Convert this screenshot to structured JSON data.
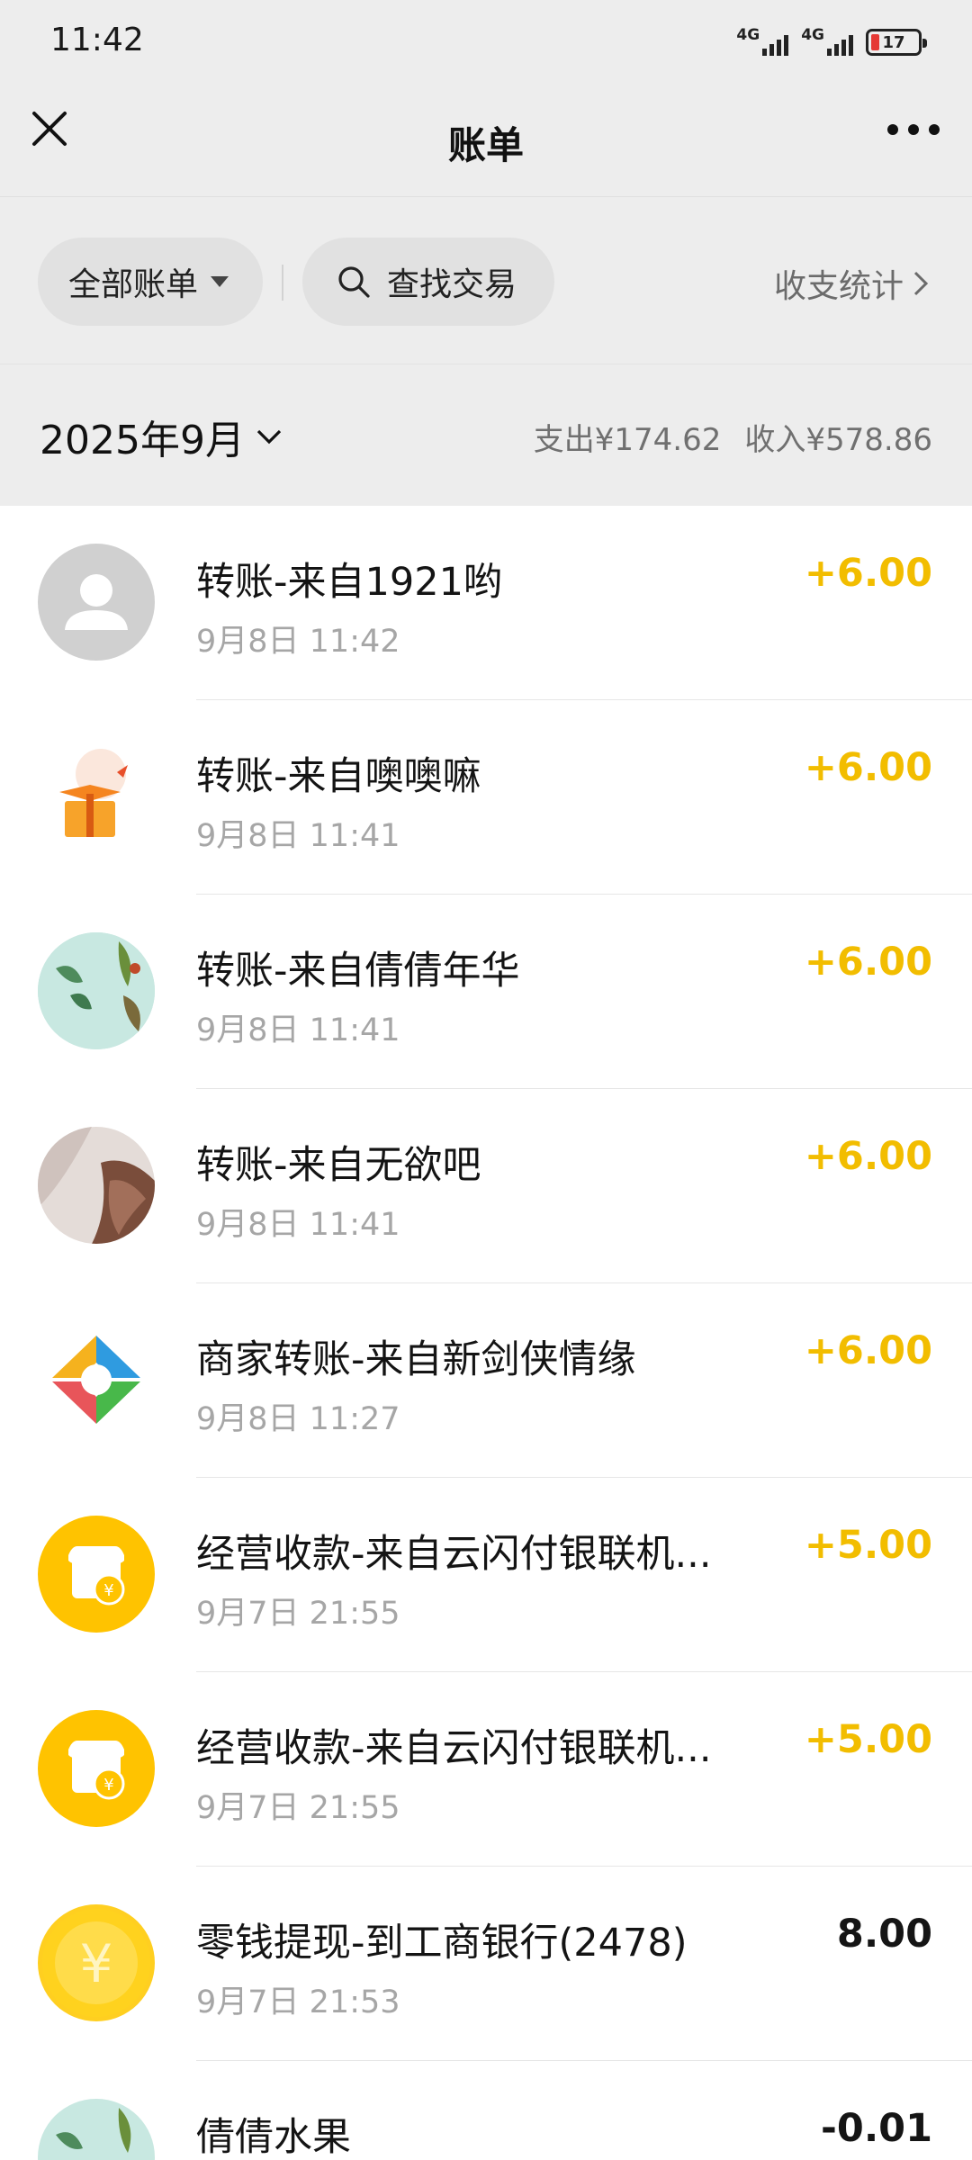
{
  "status": {
    "time": "11:42",
    "network1": "4G",
    "network2": "4G",
    "battery": "17"
  },
  "nav": {
    "title": "账单"
  },
  "toolbar": {
    "filter_label": "全部账单",
    "search_label": "查找交易",
    "stats_label": "收支统计"
  },
  "month": {
    "label": "2025年9月",
    "expense": "支出¥174.62",
    "income": "收入¥578.86"
  },
  "transactions": [
    {
      "title": "转账-来自1921哟",
      "time": "9月8日 11:42",
      "amount": "+6.00",
      "type": "income",
      "avatar": "default-avatar"
    },
    {
      "title": "转账-来自噢噢嘛",
      "time": "9月8日 11:41",
      "amount": "+6.00",
      "type": "income",
      "avatar": "gift-box-avatar"
    },
    {
      "title": "转账-来自倩倩年华",
      "time": "9月8日 11:41",
      "amount": "+6.00",
      "type": "income",
      "avatar": "plant-photo-avatar"
    },
    {
      "title": "转账-来自无欲吧",
      "time": "9月8日 11:41",
      "amount": "+6.00",
      "type": "income",
      "avatar": "portrait-photo-avatar"
    },
    {
      "title": "商家转账-来自新剑侠情缘",
      "time": "9月8日 11:27",
      "amount": "+6.00",
      "type": "income",
      "avatar": "game-logo-avatar"
    },
    {
      "title": "经营收款-来自云闪付银联机...",
      "time": "9月7日 21:55",
      "amount": "+5.00",
      "type": "income",
      "avatar": "shop-icon-avatar"
    },
    {
      "title": "经营收款-来自云闪付银联机...",
      "time": "9月7日 21:55",
      "amount": "+5.00",
      "type": "income",
      "avatar": "shop-icon-avatar"
    },
    {
      "title": "零钱提现-到工商银行(2478)",
      "time": "9月7日 21:53",
      "amount": "8.00",
      "type": "expense",
      "avatar": "yuan-coin-avatar"
    },
    {
      "title": "倩倩水果",
      "time": "",
      "amount": "-0.01",
      "type": "expense",
      "avatar": "plant-photo-avatar"
    }
  ],
  "colors": {
    "income": "#f2bd00",
    "accent_yellow": "#ffc300",
    "background": "#ededed"
  }
}
